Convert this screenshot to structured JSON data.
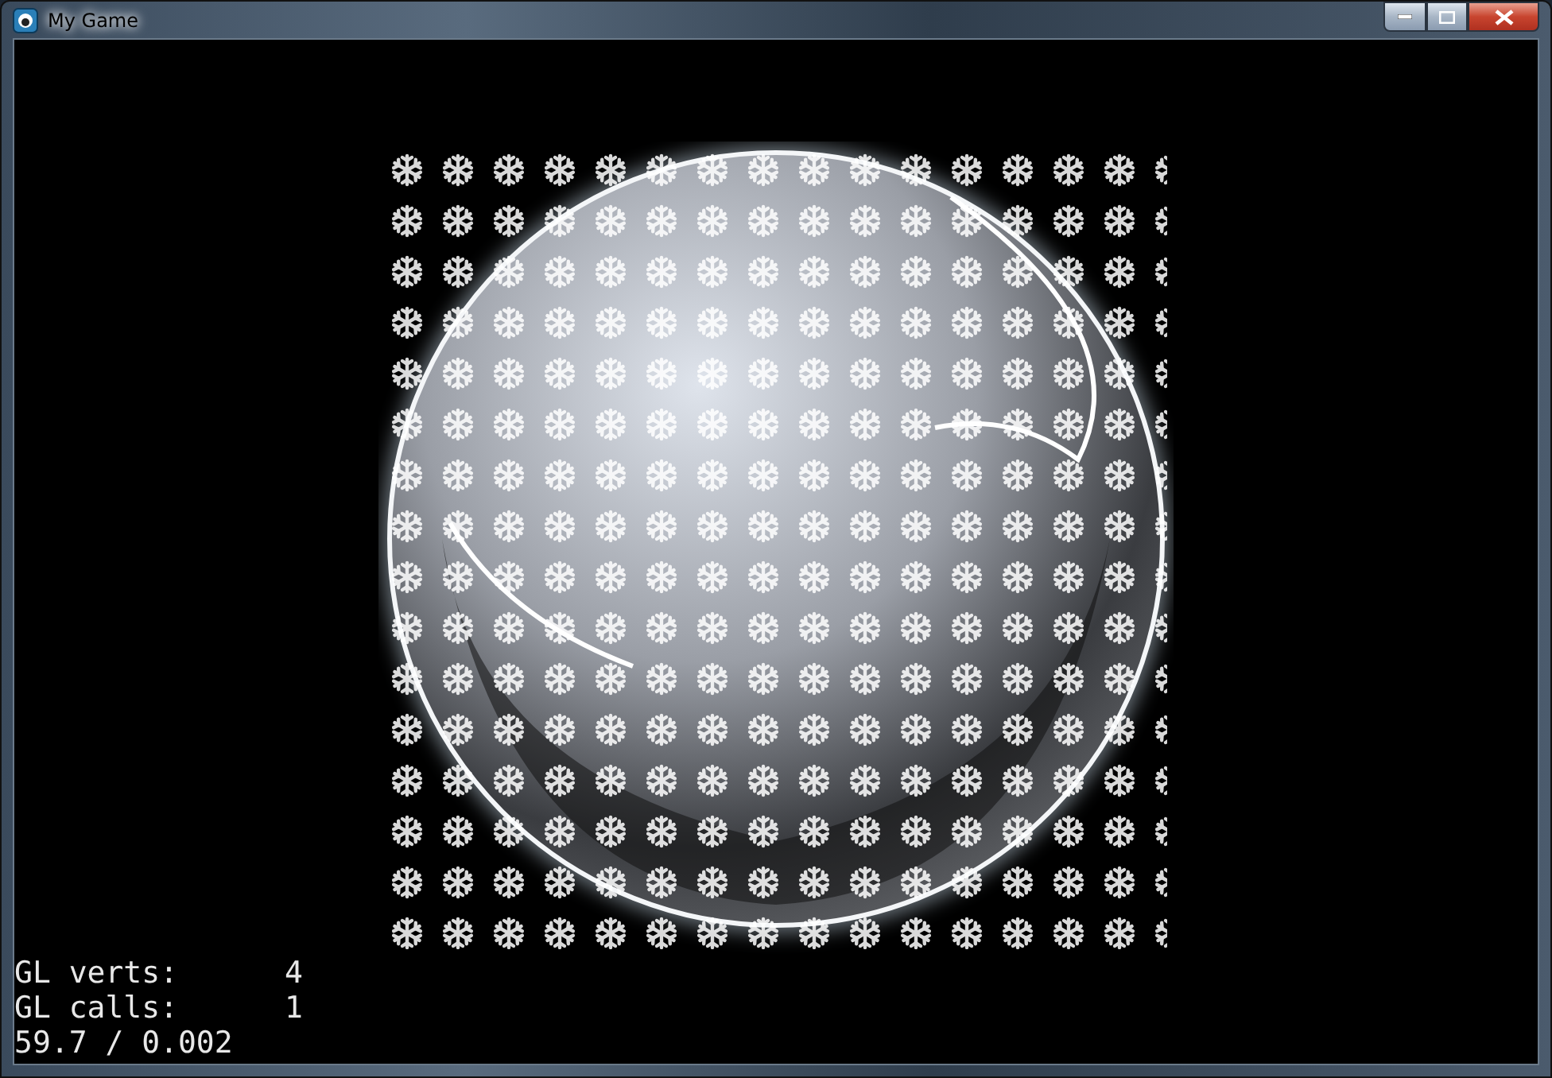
{
  "window": {
    "title": "My Game"
  },
  "stats": [
    {
      "label": "GL verts:",
      "value": "4"
    },
    {
      "label": "GL calls:",
      "value": "1"
    },
    {
      "label": "59.7 / 0.002"
    }
  ]
}
